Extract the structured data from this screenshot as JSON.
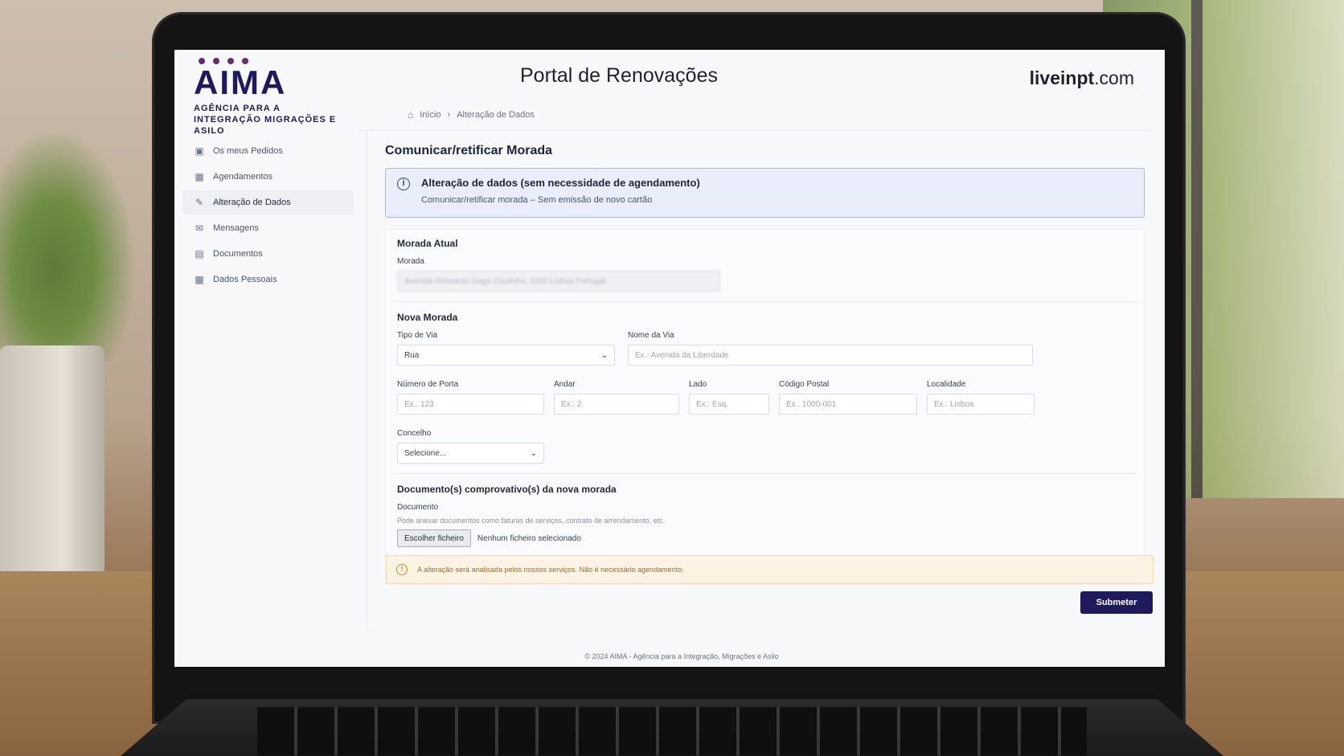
{
  "header": {
    "logo_text": "AIMA",
    "logo_subtitle": "AGÊNCIA PARA A INTEGRAÇÃO MIGRAÇÕES E ASILO",
    "title": "Portal de Renovações",
    "brand_bold": "liveinpt",
    "brand_rest": ".com"
  },
  "breadcrumb": {
    "home": "Início",
    "current": "Alteração de Dados"
  },
  "sidebar": {
    "items": [
      {
        "label": "Os meus Pedidos",
        "icon": "clipboard-icon"
      },
      {
        "label": "Agendamentos",
        "icon": "calendar-icon"
      },
      {
        "label": "Alteração de Dados",
        "icon": "pencil-icon"
      },
      {
        "label": "Mensagens",
        "icon": "mail-icon"
      },
      {
        "label": "Documentos",
        "icon": "document-icon"
      },
      {
        "label": "Dados Pessoais",
        "icon": "user-card-icon"
      }
    ]
  },
  "main": {
    "page_title": "Comunicar/retificar Morada",
    "info": {
      "title": "Alteração de dados (sem necessidade de agendamento)",
      "text": "Comunicar/retificar morada – Sem emissão de novo cartão"
    },
    "current": {
      "section": "Morada Atual",
      "label": "Morada",
      "value": "Avenida Almirante Gago Coutinho, 1000 Lisboa Portugal"
    },
    "new": {
      "section": "Nova Morada",
      "tipo_via_label": "Tipo de Via",
      "tipo_via_value": "Rua",
      "nome_via_label": "Nome da Via",
      "nome_via_placeholder": "Ex.: Avenida da Liberdade",
      "porta_label": "Número de Porta",
      "porta_placeholder": "Ex.: 123",
      "andar_label": "Andar",
      "andar_placeholder": "Ex.: 2",
      "lado_label": "Lado",
      "lado_placeholder": "Ex.: Esq.",
      "cp_label": "Código Postal",
      "cp_placeholder": "Ex.: 1000-001",
      "localidade_label": "Localidade",
      "localidade_placeholder": "Ex.: Lisboa",
      "concelho_label": "Concelho",
      "concelho_value": "Selecione..."
    },
    "docs": {
      "section": "Documento(s) comprovativo(s) da nova morada",
      "label": "Documento",
      "hint": "Pode anexar documentos como faturas de serviços, contrato de arrendamento, etc.",
      "button": "Escolher ficheiro",
      "status": "Nenhum ficheiro selecionado"
    },
    "warning": "A alteração será analisada pelos nossos serviços. Não é necessário agendamento.",
    "submit": "Submeter"
  },
  "footer": "© 2024 AIMA - Agência para a Integração, Migrações e Asilo"
}
